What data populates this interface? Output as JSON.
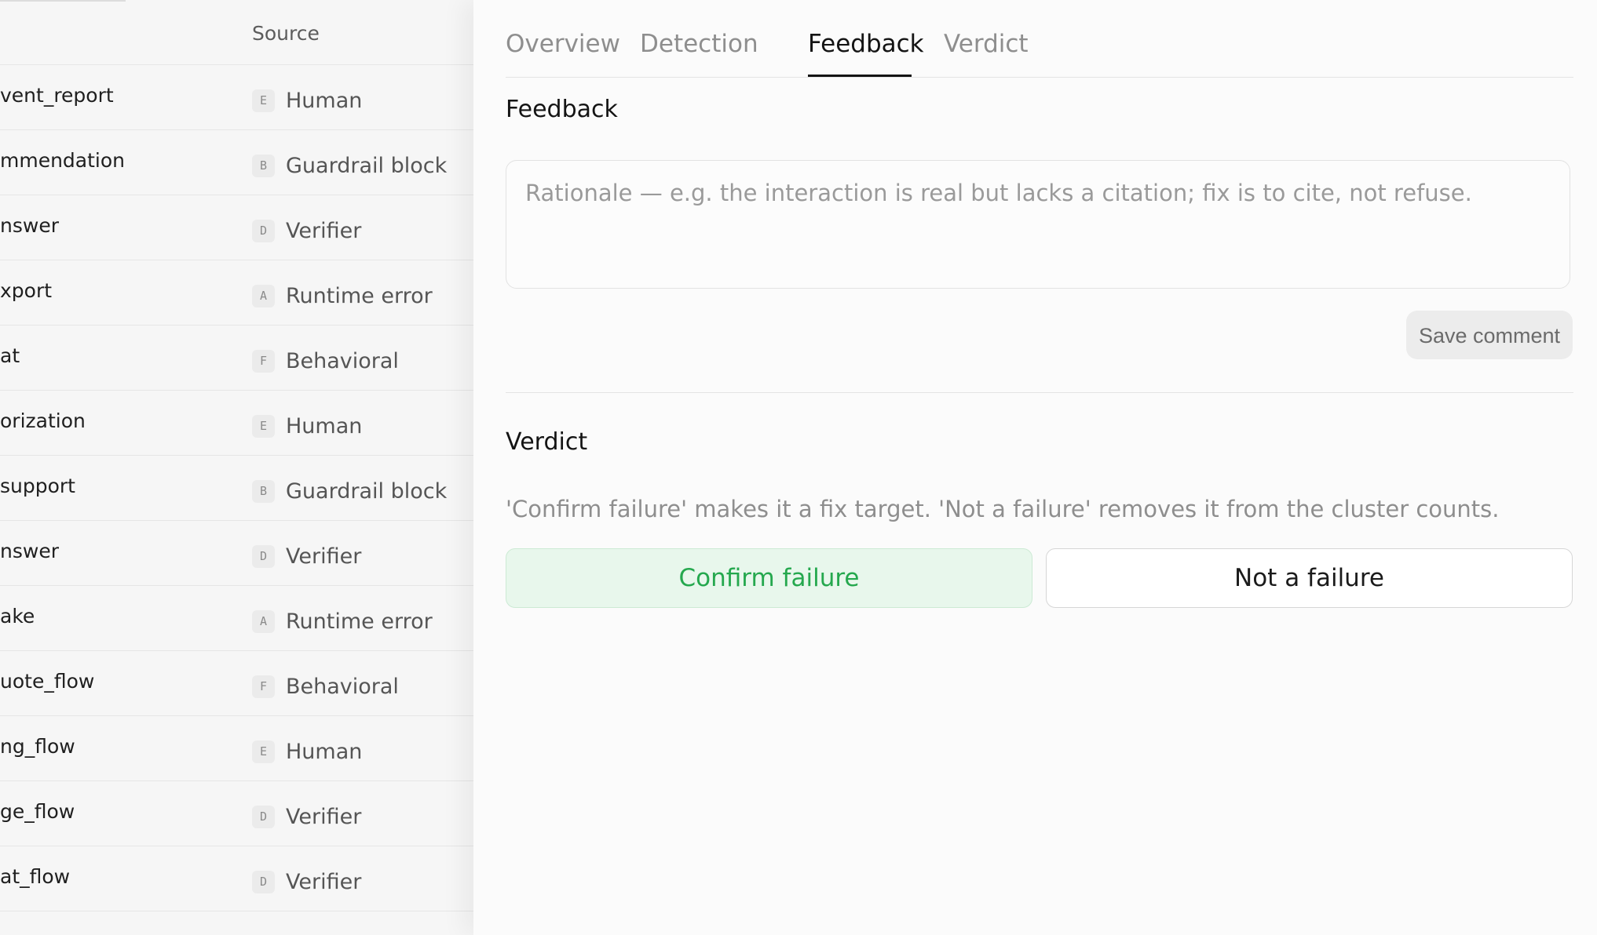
{
  "table": {
    "header_source": "Source",
    "rows": [
      {
        "name": "vent_report",
        "badge": "E",
        "source": "Human"
      },
      {
        "name": "mmendation",
        "badge": "B",
        "source": "Guardrail block"
      },
      {
        "name": "nswer",
        "badge": "D",
        "source": "Verifier"
      },
      {
        "name": "xport",
        "badge": "A",
        "source": "Runtime error"
      },
      {
        "name": "at",
        "badge": "F",
        "source": "Behavioral"
      },
      {
        "name": "orization",
        "badge": "E",
        "source": "Human"
      },
      {
        "name": "support",
        "badge": "B",
        "source": "Guardrail block"
      },
      {
        "name": "nswer",
        "badge": "D",
        "source": "Verifier"
      },
      {
        "name": "ake",
        "badge": "A",
        "source": "Runtime error"
      },
      {
        "name": "uote_flow",
        "badge": "F",
        "source": "Behavioral"
      },
      {
        "name": "ng_flow",
        "badge": "E",
        "source": "Human"
      },
      {
        "name": "ge_flow",
        "badge": "D",
        "source": "Verifier"
      },
      {
        "name": "at_flow",
        "badge": "D",
        "source": "Verifier"
      }
    ]
  },
  "tabs": [
    {
      "label": "Overview",
      "active": false
    },
    {
      "label": "Detection",
      "active": false
    },
    {
      "label": "Feedback",
      "active": true
    },
    {
      "label": "Verdict",
      "active": false
    }
  ],
  "feedback": {
    "title": "Feedback",
    "value": "",
    "placeholder": "Rationale — e.g. the interaction is real but lacks a citation; fix is to cite, not refuse.",
    "save_label": "Save comment"
  },
  "verdict": {
    "title": "Verdict",
    "hint": "'Confirm failure' makes it a fix target. 'Not a failure' removes it from the cluster counts.",
    "confirm_label": "Confirm failure",
    "not_failure_label": "Not a failure"
  },
  "colors": {
    "accent_green": "#25a84e",
    "confirm_bg": "#e8f7ec",
    "active_tab": "#141414",
    "inactive_tab": "#8e8e8e"
  }
}
